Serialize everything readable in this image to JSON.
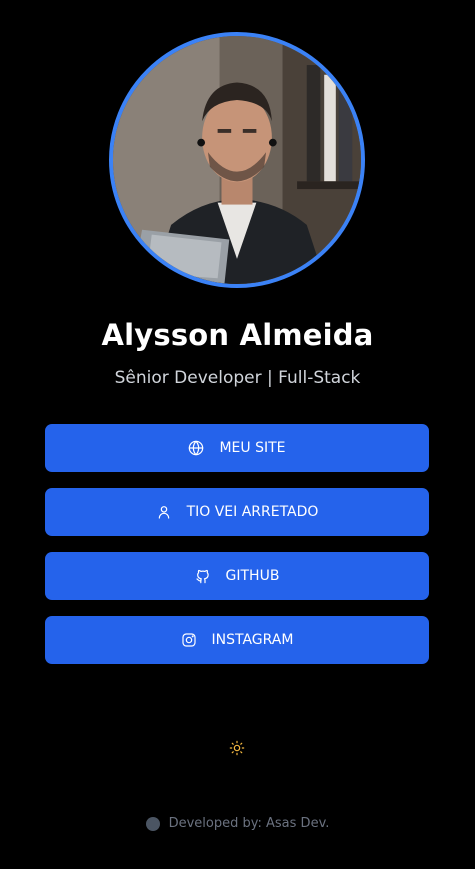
{
  "profile": {
    "name": "Alysson Almeida",
    "role": "Sênior Developer | Full-Stack"
  },
  "links": [
    {
      "label": "MEU SITE",
      "icon": "globe-icon"
    },
    {
      "label": "TIO VEI ARRETADO",
      "icon": "user-icon"
    },
    {
      "label": "GITHUB",
      "icon": "github-icon"
    },
    {
      "label": "INSTAGRAM",
      "icon": "instagram-icon"
    }
  ],
  "theme_toggle": {
    "icon": "sun-icon"
  },
  "footer": {
    "text": "Developed by: Asas Dev.",
    "icon": "logo-dot-icon"
  },
  "colors": {
    "background": "#000000",
    "accent": "#2563eb",
    "avatar_border": "#3b82f6",
    "sun": "#f5b942"
  }
}
